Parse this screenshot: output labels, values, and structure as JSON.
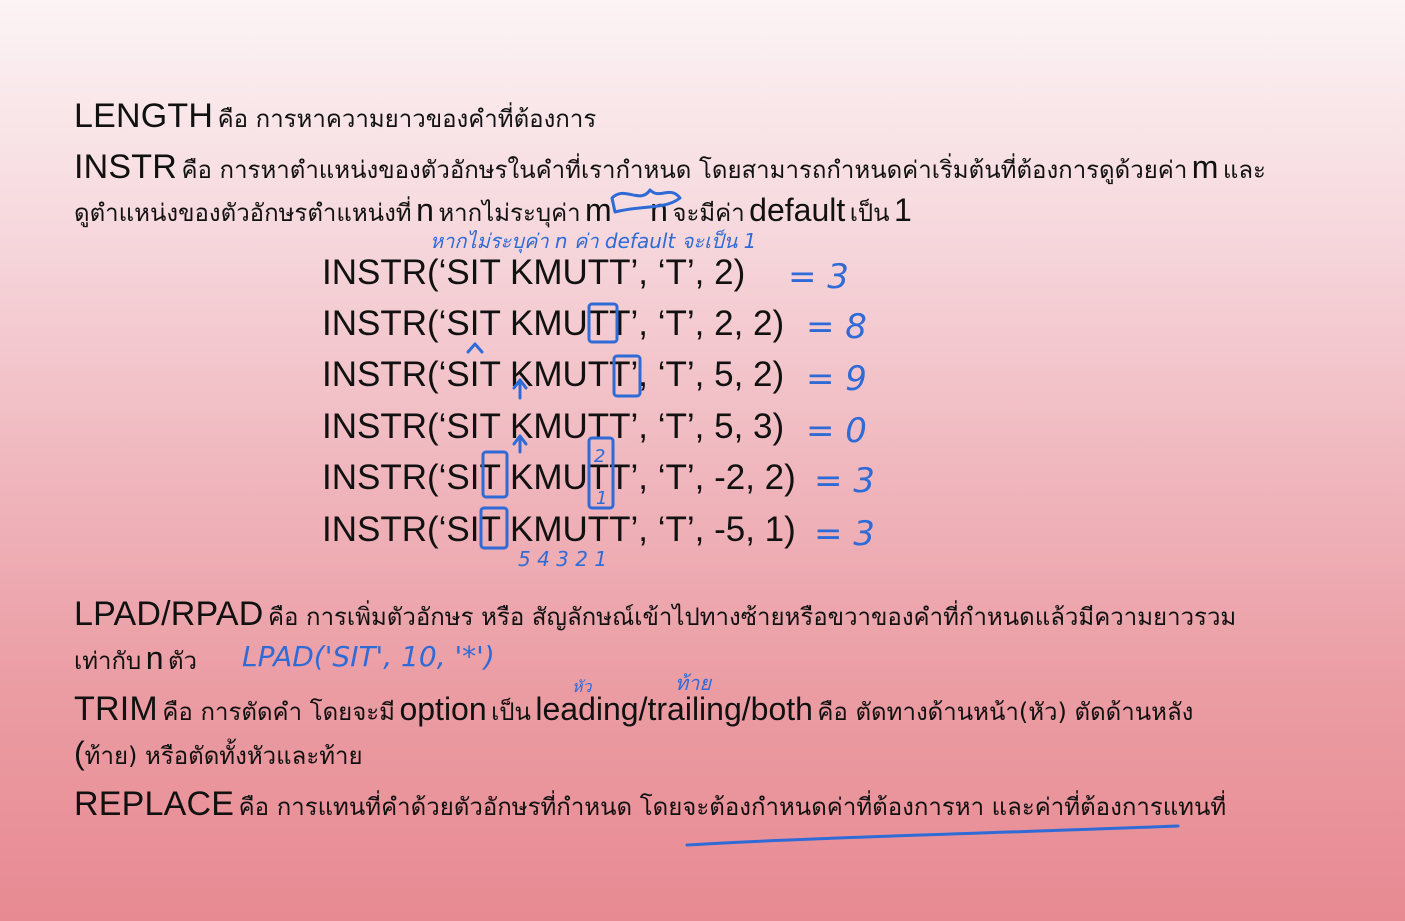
{
  "definitions": {
    "length": {
      "keyword": "LENGTH",
      "desc": "คือ การหาความยาวของคำที่ต้องการ"
    },
    "instr": {
      "keyword": "INSTR",
      "desc1": "คือ การหาตำแหน่งของตัวอักษรในคำที่เรากำหนด โดยสามารถกำหนดค่าเริ่มต้นที่ต้องการดูด้วยค่า",
      "m": "m",
      "and": "และ",
      "desc2": "ดูตำแหน่งของตัวอักษรตำแหน่งที่",
      "n": "n",
      "if_not": "หากไม่ระบุค่า",
      "m2": "m",
      "n2": "n",
      "will_be": "จะมีค่า",
      "default": "default",
      "is": "เป็น",
      "one": "1"
    },
    "lpad": {
      "keyword": "LPAD/RPAD",
      "desc1": "คือ การเพิ่มตัวอักษร หรือ สัญลักษณ์เข้าไปทางซ้ายหรือขวาของคำที่กำหนดแล้วมีความยาวรวม",
      "desc2a": "เท่ากับ",
      "n": "n",
      "desc2b": "ตัว"
    },
    "trim": {
      "keyword": "TRIM",
      "desc1a": "คือ การตัดคำ โดยจะมี",
      "option": "option",
      "desc1b": "เป็น",
      "modes": "leading/trailing/both",
      "desc1c": "คือ ตัดทางด้านหน้า(หัว) ตัดด้านหลัง",
      "paren": "(",
      "desc2": "ท้าย) หรือตัดทั้งหัวและท้าย"
    },
    "replace": {
      "keyword": "REPLACE",
      "desc": "คือ การแทนที่คำด้วยตัวอักษรที่กำหนด  โดยจะต้องกำหนดค่าที่ต้องการหา และค่าที่ต้องการแทนที่"
    }
  },
  "examples": [
    "INSTR(‘SIT KMUTT’, ‘T’, 2)",
    "INSTR(‘SIT KMUTT’, ‘T’, 2, 2)",
    "INSTR(‘SIT KMUTT’, ‘T’, 5, 2)",
    "INSTR(‘SIT KMUTT’, ‘T’, 5, 3)",
    "INSTR(‘SIT KMUTT’, ‘T’, -2, 2)",
    "INSTR(‘SIT KMUTT’, ‘T’, -5, 1)"
  ],
  "handwriting": {
    "instr_note": "หากไม่ระบุค่า n ค่า default จะเป็น 1",
    "results": [
      "= 3",
      "= 8",
      "= 9",
      "= 0",
      "= 3",
      "= 3"
    ],
    "positions": "5 4 3 2 1",
    "pos_labels": [
      "2",
      "1"
    ],
    "lpad_example": "LPAD('SIT', 10, '*')",
    "head": "หัว",
    "tail": "ท้าย",
    "ink_color": "#2f6bd6"
  }
}
